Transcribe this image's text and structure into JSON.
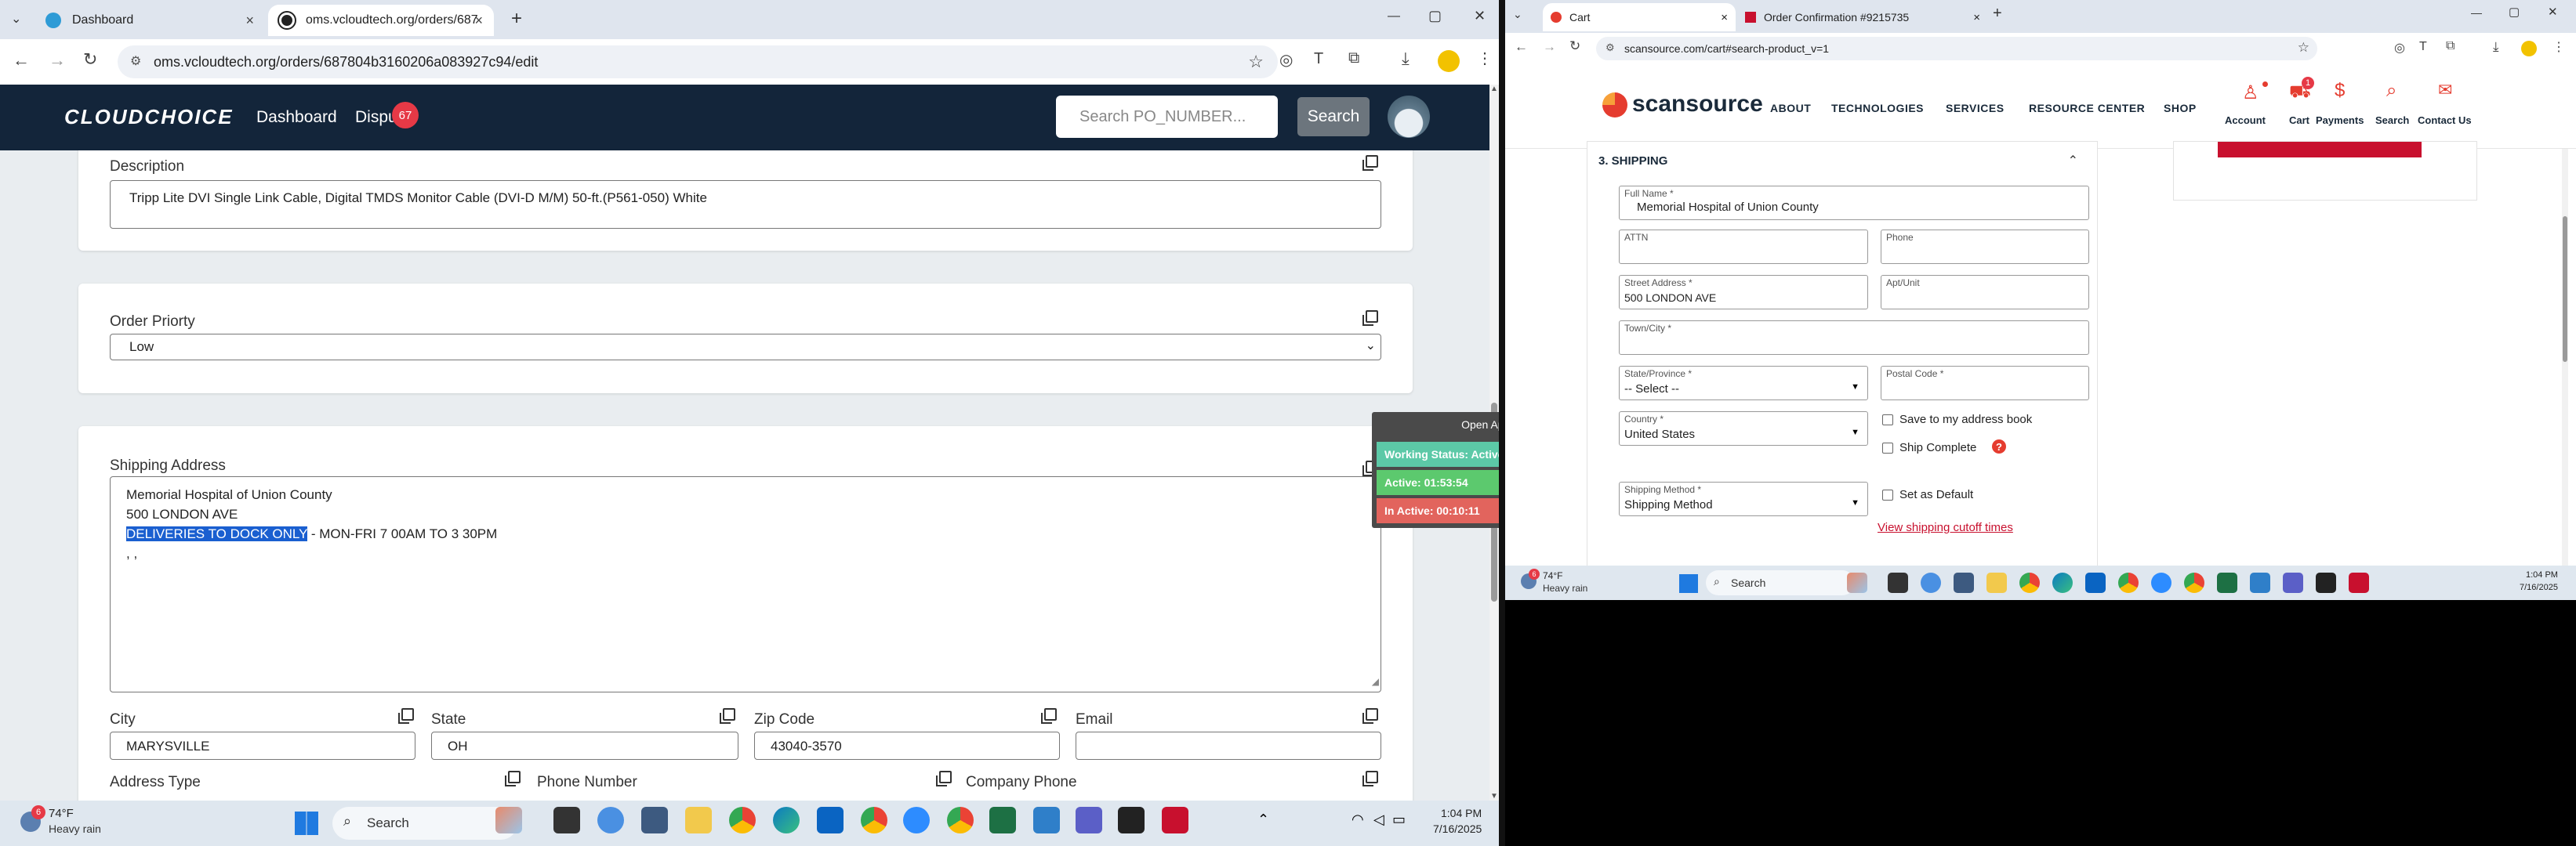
{
  "left_browser": {
    "tabs": [
      {
        "title": "Dashboard",
        "close": "×"
      },
      {
        "title": "oms.vcloudtech.org/orders/687",
        "close": "×"
      }
    ],
    "new_tab": "+",
    "url": "oms.vcloudtech.org/orders/687804b3160206a083927c94/edit",
    "window_controls": {
      "min": "—",
      "max": "▢",
      "close": "✕"
    }
  },
  "app": {
    "brand": "CLOUDCHOICE",
    "nav": [
      {
        "label": "Dashboard"
      },
      {
        "label": "Dispu",
        "badge": "67"
      }
    ],
    "search_placeholder": "Search PO_NUMBER...",
    "search_button": "Search"
  },
  "form": {
    "description": {
      "label": "Description",
      "value": "Tripp Lite DVI Single Link Cable, Digital TMDS Monitor Cable (DVI-D M/M) 50-ft.(P561-050) White"
    },
    "order_priority": {
      "label": "Order Priorty",
      "value": "Low"
    },
    "shipping_address": {
      "label": "Shipping Address",
      "lines": [
        "Memorial Hospital of Union County",
        "500 LONDON AVE"
      ],
      "highlighted": "DELIVERIES TO DOCK ONLY",
      "line3_rest": " - MON-FRI 7 00AM TO 3 30PM",
      "line4": ", ,"
    },
    "city": {
      "label": "City",
      "value": "MARYSVILLE"
    },
    "state": {
      "label": "State",
      "value": "OH"
    },
    "zip": {
      "label": "Zip Code",
      "value": "43040-3570"
    },
    "email": {
      "label": "Email",
      "value": ""
    },
    "address_type": {
      "label": "Address Type"
    },
    "phone_number": {
      "label": "Phone Number"
    },
    "company_phone": {
      "label": "Company Phone"
    }
  },
  "status_overlay": {
    "open_app": "Open App ↗",
    "working_status": "Working Status: Active",
    "active": "Active: 01:53:54",
    "inactive": "In Active: 00:10:11"
  },
  "left_taskbar": {
    "weather_badge": "6",
    "temp": "74°F",
    "condition": "Heavy rain",
    "search": "Search",
    "time": "1:04 PM",
    "date": "7/16/2025"
  },
  "right_browser": {
    "tabs": [
      {
        "title": "Cart",
        "close": "×"
      },
      {
        "title": "Order Confirmation #9215735",
        "close": "×"
      }
    ],
    "new_tab": "+",
    "url": "scansource.com/cart#search-product_v=1",
    "window_controls": {
      "min": "—",
      "max": "▢",
      "close": "✕"
    }
  },
  "scansource": {
    "logo": "scansource",
    "menu": [
      "ABOUT",
      "TECHNOLOGIES",
      "SERVICES",
      "RESOURCE CENTER",
      "SHOP"
    ],
    "actions": [
      {
        "label": "Account"
      },
      {
        "label": "Cart",
        "badge": "1"
      },
      {
        "label": "Payments"
      },
      {
        "label": "Search"
      },
      {
        "label": "Contact Us"
      }
    ],
    "section_title": "3. SHIPPING",
    "fields": {
      "full_name": {
        "label": "Full Name *",
        "value": "Memorial Hospital of Union County"
      },
      "attn": {
        "label": "ATTN",
        "value": ""
      },
      "phone": {
        "label": "Phone",
        "value": ""
      },
      "street": {
        "label": "Street Address *",
        "value": "500 LONDON AVE"
      },
      "apt": {
        "label": "Apt/Unit",
        "value": ""
      },
      "town": {
        "label": "Town/City *",
        "value": ""
      },
      "state": {
        "label": "State/Province *",
        "value": "-- Select --"
      },
      "postal": {
        "label": "Postal Code *",
        "value": ""
      },
      "country": {
        "label": "Country *",
        "value": "United States"
      },
      "shipping_method": {
        "label": "Shipping Method *",
        "value": "Shipping Method"
      }
    },
    "save_address": "Save to my address book",
    "ship_complete": "Ship Complete",
    "set_default": "Set as Default",
    "cutoff_link": "View shipping cutoff times"
  },
  "right_taskbar": {
    "weather_badge": "6",
    "temp": "74°F",
    "condition": "Heavy rain",
    "search": "Search",
    "time": "1:04 PM",
    "date": "7/16/2025"
  }
}
